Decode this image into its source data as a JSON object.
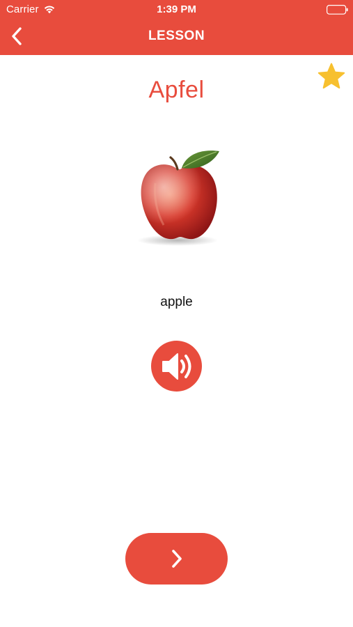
{
  "status_bar": {
    "carrier": "Carrier",
    "time": "1:39 PM",
    "wifi_icon": "wifi-icon",
    "battery_icon": "battery-icon"
  },
  "nav": {
    "title": "LESSON",
    "back_icon": "chevron-left-icon"
  },
  "lesson": {
    "word": "Apfel",
    "translation": "apple",
    "image_subject": "apple",
    "favorite_icon": "star-icon",
    "audio_icon": "speaker-icon",
    "next_icon": "chevron-right-icon"
  },
  "colors": {
    "accent": "#e84c3d",
    "star": "#f7c02f",
    "background": "#ffffff"
  }
}
